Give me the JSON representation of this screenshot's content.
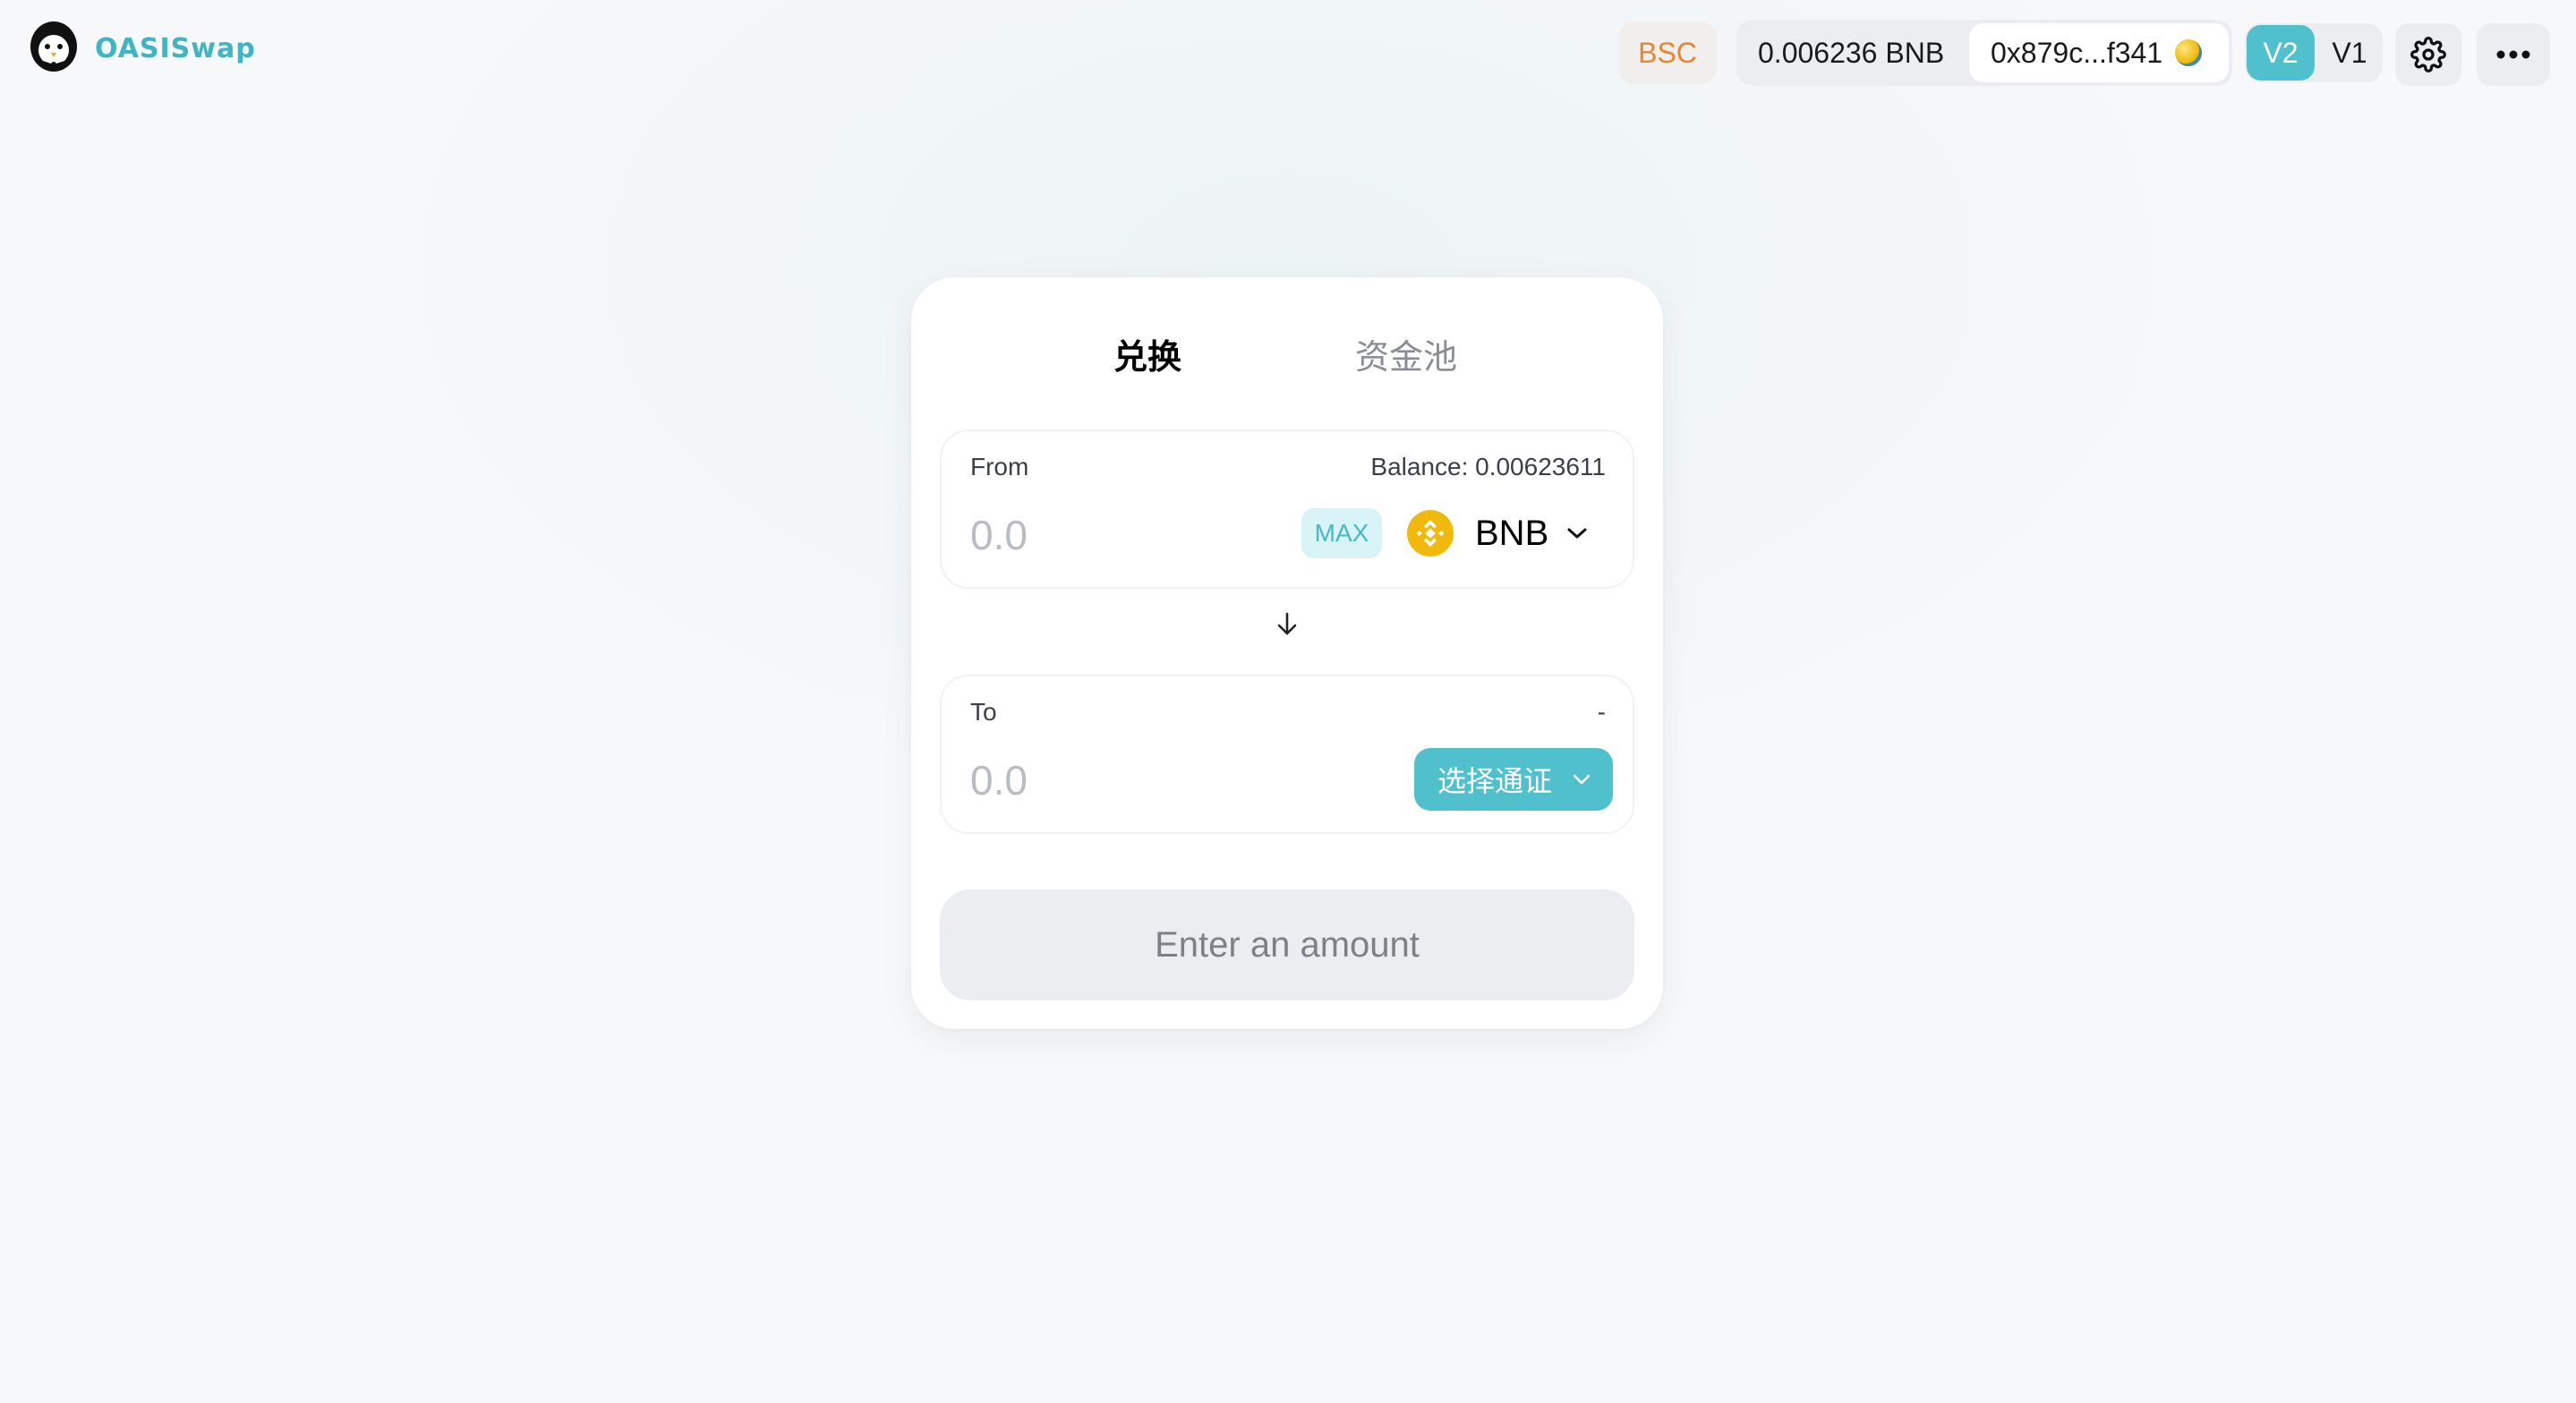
{
  "app": {
    "name": "OASISwap",
    "logo_icon": "penguin-logo-icon"
  },
  "header": {
    "network": "BSC",
    "balance": "0.006236 BNB",
    "address": "0x879c...f341",
    "address_icon": "wallet-avatar-icon",
    "versions": [
      "V2",
      "V1"
    ],
    "active_version": "V2",
    "settings_icon": "gear-icon",
    "more_icon": "ellipsis-icon"
  },
  "card": {
    "tabs": [
      {
        "label": "兑换",
        "active": true
      },
      {
        "label": "资金池",
        "active": false
      }
    ],
    "from": {
      "label": "From",
      "balance_label": "Balance: 0.00623611",
      "amount_placeholder": "0.0",
      "max_label": "MAX",
      "token_symbol": "BNB",
      "token_icon": "bnb-icon"
    },
    "arrow_icon": "arrow-down-icon",
    "to": {
      "label": "To",
      "right_label": "-",
      "amount_placeholder": "0.0",
      "select_label": "选择通证"
    },
    "submit_label": "Enter an amount"
  },
  "colors": {
    "accent": "#4fc0cc",
    "network": "#e9842f",
    "bnb": "#f0b90b"
  }
}
